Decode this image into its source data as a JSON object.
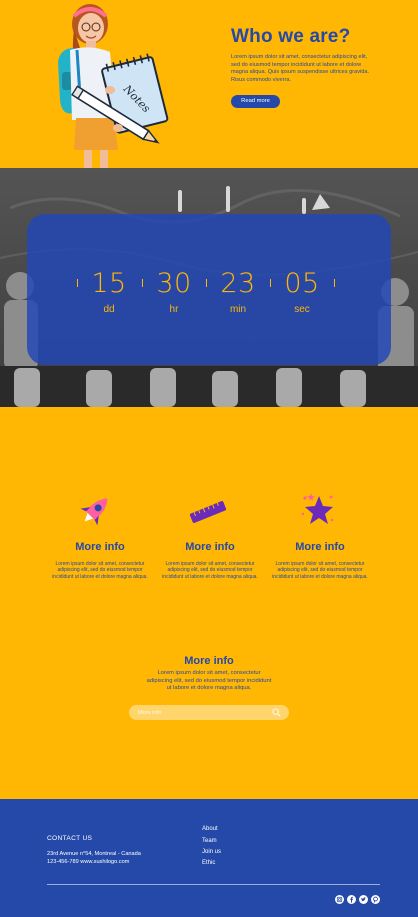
{
  "hero": {
    "title": "Who we are?",
    "text": "Lorem ipsum dolor sit amet, consectetur adipiscing elit, sed do eiusmod tempor incididunt ut labore et dolore magna aliqua. Quis ipsum suspendisse ultrices gravida. Risus commodo viverra.",
    "button_label": "Read more",
    "note_label": "Notes"
  },
  "countdown": {
    "units": [
      {
        "value": "15",
        "label": "dd"
      },
      {
        "value": "30",
        "label": "hr"
      },
      {
        "value": "23",
        "label": "min"
      },
      {
        "value": "05",
        "label": "sec"
      }
    ]
  },
  "features": [
    {
      "icon": "rocket-icon",
      "title": "More info",
      "text": "Lorem ipsum dolor sit amet, consectetur adipiscing elit, sed do eiusmod tempor incididunt ut labore et dolore magna aliqua."
    },
    {
      "icon": "ruler-icon",
      "title": "More info",
      "text": "Lorem ipsum dolor sit amet, consectetur adipiscing elit, sed do eiusmod tempor incididunt ut labore et dolore magna aliqua."
    },
    {
      "icon": "star-icon",
      "title": "More info",
      "text": "Lorem ipsum dolor sit amet, consectetur adipiscing elit, sed do eiusmod tempor incididunt ut labore et dolore magna aliqua."
    }
  ],
  "info_section": {
    "title": "More info",
    "text": "Lorem ipsum dolor sit amet, consectetur adipiscing elit, sed do eiusmod tempor incididunt ut labore et dolore magna aliqua.",
    "search_placeholder": "More info"
  },
  "footer": {
    "contact_title": "CONTACT US",
    "address": "23rd Avenue n°54, Montreal - Canada",
    "phone_site": "123-456-789 www.sushilogo.com",
    "links": [
      "About",
      "Team",
      "Join us",
      "Ethic"
    ],
    "social": [
      "instagram-icon",
      "facebook-icon",
      "twitter-icon",
      "pinterest-icon"
    ]
  },
  "colors": {
    "background": "#FFB703",
    "primary": "#2449a8",
    "accent_purple": "#6b2bb8"
  }
}
